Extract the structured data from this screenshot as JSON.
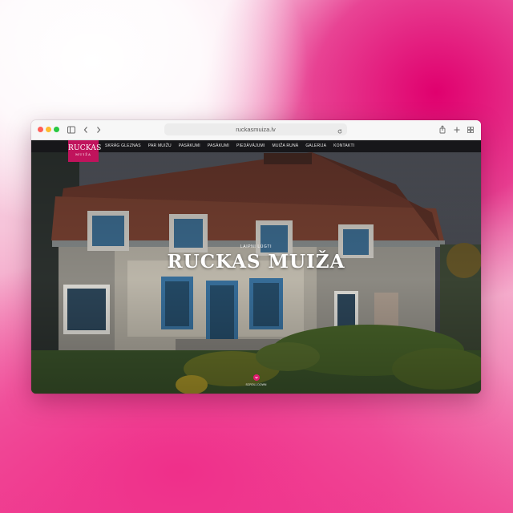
{
  "browser": {
    "url": "ruckasmuiza.lv"
  },
  "site": {
    "logo_main": "RUCKAS",
    "logo_sub": "MUIŽA",
    "nav": [
      {
        "label": "SKRĀG GLEZNAS"
      },
      {
        "label": "PAR MUIŽU"
      },
      {
        "label": "PASĀKUMI"
      },
      {
        "label": "PASĀKUMI"
      },
      {
        "label": "PIEDĀVĀJUMI"
      },
      {
        "label": "MUIŽA RUNĀ"
      },
      {
        "label": "GALERIJA"
      },
      {
        "label": "KONTAKTI"
      }
    ],
    "hero": {
      "eyebrow": "LAIPNI LŪGTI",
      "title": "RUCKAS MUIŽA",
      "scroll_label": "SCROLL DOWN"
    }
  },
  "colors": {
    "brand": "#c0135c",
    "accent": "#e01b6e"
  }
}
